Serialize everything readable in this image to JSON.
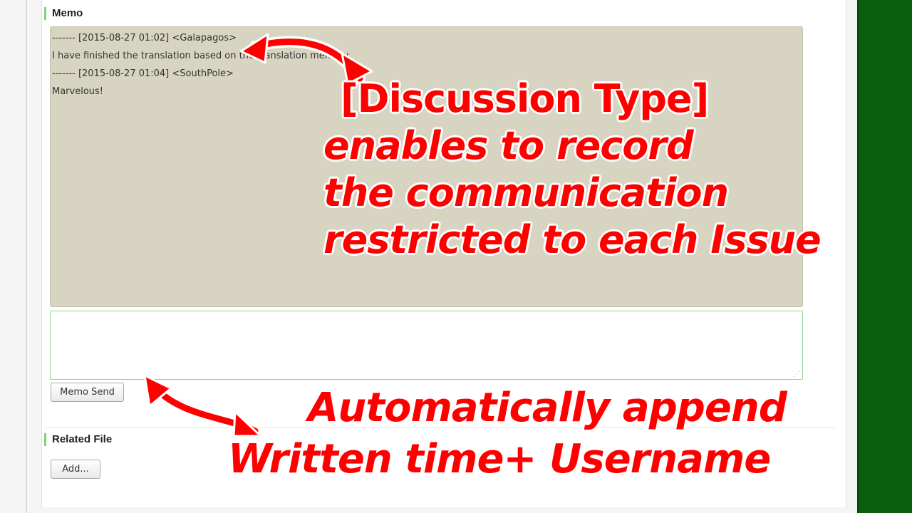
{
  "memo": {
    "title": "Memo",
    "log_lines": [
      "------- [2015-08-27 01:02] <Galapagos>",
      "I have finished the translation based on the translation memory.",
      "------- [2015-08-27 01:04] <SouthPole>",
      "Marvelous!"
    ],
    "input_value": "",
    "send_label": "Memo Send"
  },
  "related_file": {
    "title": "Related File",
    "add_label": "Add..."
  },
  "annotations": {
    "top": [
      "[Discussion Type]",
      "enables to record",
      "the communication",
      "restricted to each Issue"
    ],
    "bottom": [
      "Automatically append",
      "Written time+ Username"
    ]
  },
  "colors": {
    "annotation_text": "#ff0000",
    "memo_log_background": "#d7d4c1",
    "side_green": "#0a5f0e",
    "section_marker": "#7fd07f"
  }
}
